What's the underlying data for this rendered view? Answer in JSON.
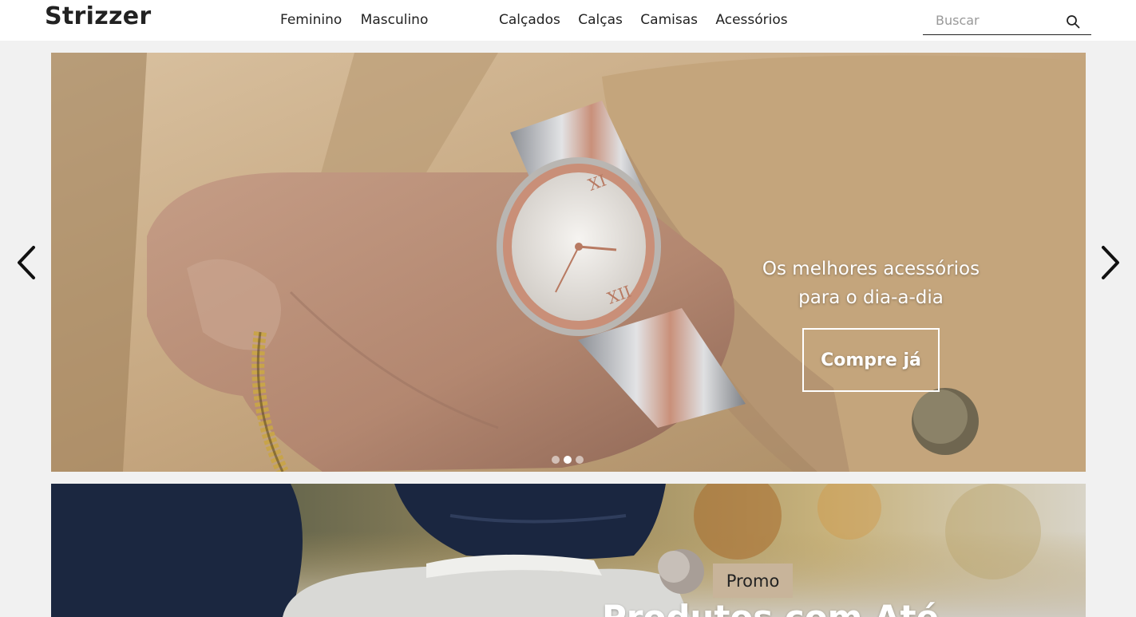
{
  "brand": {
    "logo": "Strizzer"
  },
  "nav": {
    "primary": [
      "Feminino",
      "Masculino"
    ],
    "categories": [
      "Calçados",
      "Calças",
      "Camisas",
      "Acessórios"
    ]
  },
  "search": {
    "placeholder": "Buscar",
    "value": ""
  },
  "hero": {
    "caption_line1": "Os melhores acessórios",
    "caption_line2": "para o dia-a-dia",
    "cta_label": "Compre já",
    "slide_count": 3,
    "active_slide": 2
  },
  "promo": {
    "badge": "Promo",
    "title": "Produtos com Até"
  },
  "colors": {
    "header_bg": "#ffffff",
    "page_bg": "#f1f1f1",
    "text": "#222222",
    "promo_badge": "#c8b49a",
    "coat": "#c7ab86",
    "jeans": "#1b2740"
  },
  "icons": {
    "search": "search-icon",
    "prev": "chevron-left-icon",
    "next": "chevron-right-icon"
  }
}
